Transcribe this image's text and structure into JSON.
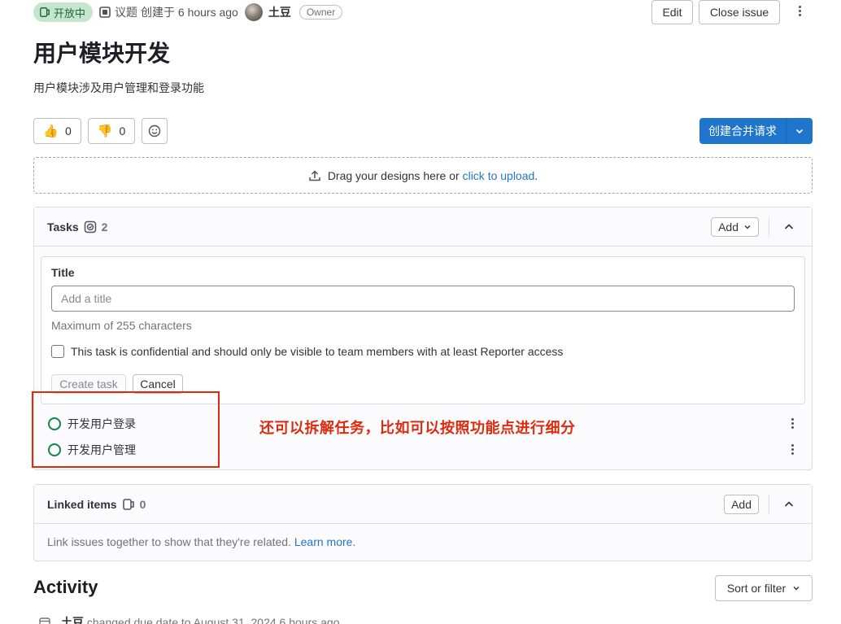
{
  "status": {
    "label": "开放中",
    "color": "#108548"
  },
  "meta": {
    "type_label": "议题",
    "created_text": "创建于 6 hours ago",
    "author": "土豆",
    "author_role": "Owner"
  },
  "header_actions": {
    "edit": "Edit",
    "close": "Close issue"
  },
  "issue": {
    "title": "用户模块开发",
    "description": "用户模块涉及用户管理和登录功能"
  },
  "reactions": {
    "thumbs_up": "0",
    "thumbs_down": "0"
  },
  "merge_request_button": "创建合并请求",
  "dropzone": {
    "text": "Drag your designs here or ",
    "link": "click to upload",
    "suffix": "."
  },
  "tasks": {
    "title": "Tasks",
    "count": "2",
    "add_label": "Add",
    "form": {
      "title_label": "Title",
      "title_placeholder": "Add a title",
      "hint": "Maximum of 255 characters",
      "confidential_label": "This task is confidential and should only be visible to team members with at least Reporter access",
      "create": "Create task",
      "cancel": "Cancel"
    },
    "items": [
      {
        "title": "开发用户登录"
      },
      {
        "title": "开发用户管理"
      }
    ]
  },
  "annotation": "还可以拆解任务，比如可以按照功能点进行细分",
  "linked": {
    "title": "Linked items",
    "count": "0",
    "add_label": "Add",
    "body": "Link issues together to show that they're related. ",
    "learn_more": "Learn more."
  },
  "activity": {
    "title": "Activity",
    "sort_label": "Sort or filter",
    "first_event": {
      "author": "土豆",
      "text": "changed due date to August 31, 2024 6 hours ago"
    }
  },
  "colors": {
    "accent": "#1f75cb",
    "annotation": "#dd2b0e",
    "open_badge_bg": "#c3e6cd"
  }
}
